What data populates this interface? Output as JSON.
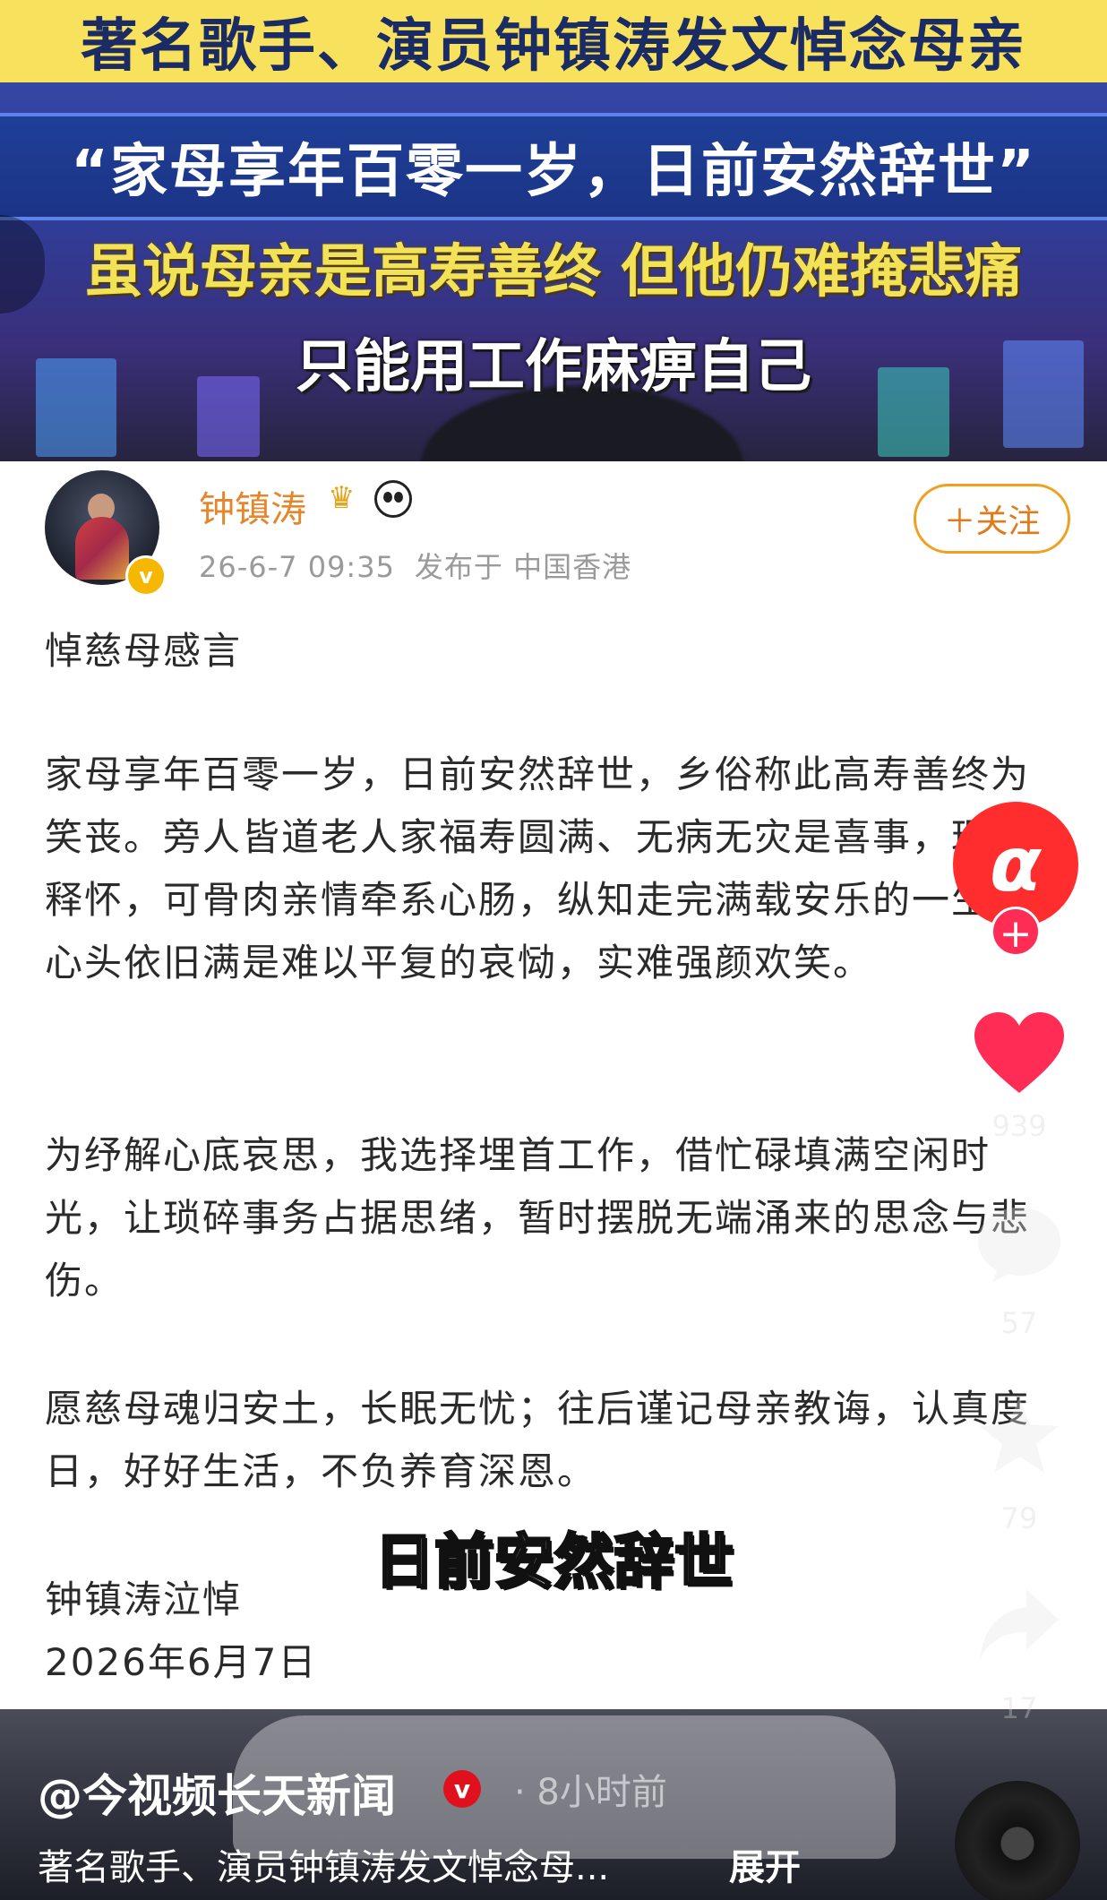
{
  "header_video": {
    "title": "著名歌手、演员钟镇涛发文悼念母亲",
    "quote": "“家母享年百零一岁，日前安然辞世”",
    "subtitle_line1": "虽说母亲是高寿善终  但他仍难掩悲痛",
    "subtitle_line2": "只能用工作麻痹自己"
  },
  "post": {
    "author": "钟镇涛",
    "timestamp": "26-6-7 09:35",
    "location": "发布于 中国香港",
    "follow_label": "＋关注",
    "verified_badge": "v",
    "heading": "悼慈母感言",
    "paragraphs": [
      "家母享年百零一岁，日前安然辞世，乡俗称此高寿善终为笑丧。旁人皆道老人家福寿圆满、无病无灾是喜事，理当释怀，可骨肉亲情牵系心肠，纵知走完满载安乐的一生，心头依旧满是难以平复的哀恸，实难强颜欢笑。",
      "为纾解心底哀思，我选择埋首工作，借忙碌填满空闲时光，让琐碎事务占据思绪，暂时摆脱无端涌来的思念与悲伤。",
      "愿慈母魂归安土，长眠无忧；往后谨记母亲教诲，认真度日，好好生活，不负养育深恩。"
    ],
    "signature": "钟镇涛泣悼",
    "date": "2026年6月7日"
  },
  "video_caption": "日前安然辞世",
  "rail": {
    "brand_glyph": "α",
    "follow_plus": "+",
    "like_count": "939",
    "comment_count": "57",
    "favorite_count": "79",
    "share_count": "17",
    "like_color": "#ff2c55"
  },
  "footer": {
    "account": "@今视频长天新闻",
    "verified": "v",
    "time_ago": "· 8小时前",
    "description": "著名歌手、演员钟镇涛发文悼念母...",
    "expand_label": "展开"
  }
}
